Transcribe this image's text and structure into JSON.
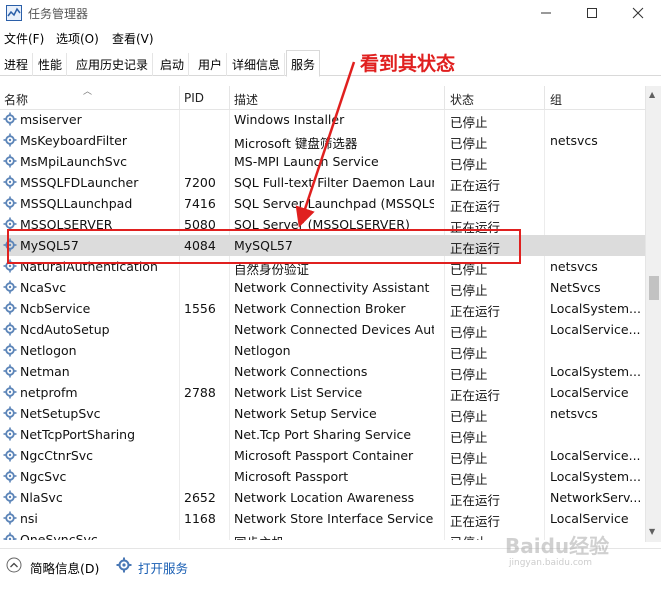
{
  "window": {
    "title": "任务管理器",
    "controls": {
      "minimize_icon": "minimize-icon",
      "maximize_icon": "maximize-icon",
      "close_icon": "close-icon"
    }
  },
  "menu": [
    "文件(F)",
    "选项(O)",
    "查看(V)"
  ],
  "tabs": [
    {
      "label": "进程",
      "active": false
    },
    {
      "label": "性能",
      "active": false
    },
    {
      "label": "应用历史记录",
      "active": false
    },
    {
      "label": "启动",
      "active": false
    },
    {
      "label": "用户",
      "active": false
    },
    {
      "label": "详细信息",
      "active": false
    },
    {
      "label": "服务",
      "active": true
    }
  ],
  "columns": {
    "name": "名称",
    "pid": "PID",
    "description": "描述",
    "status": "状态",
    "group": "组"
  },
  "rows": [
    {
      "name": "msiserver",
      "pid": "",
      "description": "Windows Installer",
      "status": "已停止",
      "group": ""
    },
    {
      "name": "MsKeyboardFilter",
      "pid": "",
      "description": "Microsoft 键盘筛选器",
      "status": "已停止",
      "group": "netsvcs"
    },
    {
      "name": "MsMpiLaunchSvc",
      "pid": "",
      "description": "MS-MPI Launch Service",
      "status": "已停止",
      "group": ""
    },
    {
      "name": "MSSQLFDLauncher",
      "pid": "7200",
      "description": "SQL Full-text Filter Daemon Laun...",
      "status": "正在运行",
      "group": ""
    },
    {
      "name": "MSSQLLaunchpad",
      "pid": "7416",
      "description": "SQL Server Launchpad (MSSQLS...",
      "status": "正在运行",
      "group": ""
    },
    {
      "name": "MSSQLSERVER",
      "pid": "5080",
      "description": "SQL Server (MSSQLSERVER)",
      "status": "正在运行",
      "group": ""
    },
    {
      "name": "MySQL57",
      "pid": "4084",
      "description": "MySQL57",
      "status": "正在运行",
      "group": "",
      "selected": true
    },
    {
      "name": "NaturalAuthentication",
      "pid": "",
      "description": "自然身份验证",
      "status": "已停止",
      "group": "netsvcs"
    },
    {
      "name": "NcaSvc",
      "pid": "",
      "description": "Network Connectivity Assistant",
      "status": "已停止",
      "group": "NetSvcs"
    },
    {
      "name": "NcbService",
      "pid": "1556",
      "description": "Network Connection Broker",
      "status": "正在运行",
      "group": "LocalSystem..."
    },
    {
      "name": "NcdAutoSetup",
      "pid": "",
      "description": "Network Connected Devices Auto...",
      "status": "已停止",
      "group": "LocalService..."
    },
    {
      "name": "Netlogon",
      "pid": "",
      "description": "Netlogon",
      "status": "已停止",
      "group": ""
    },
    {
      "name": "Netman",
      "pid": "",
      "description": "Network Connections",
      "status": "已停止",
      "group": "LocalSystem..."
    },
    {
      "name": "netprofm",
      "pid": "2788",
      "description": "Network List Service",
      "status": "正在运行",
      "group": "LocalService"
    },
    {
      "name": "NetSetupSvc",
      "pid": "",
      "description": "Network Setup Service",
      "status": "已停止",
      "group": "netsvcs"
    },
    {
      "name": "NetTcpPortSharing",
      "pid": "",
      "description": "Net.Tcp Port Sharing Service",
      "status": "已停止",
      "group": ""
    },
    {
      "name": "NgcCtnrSvc",
      "pid": "",
      "description": "Microsoft Passport Container",
      "status": "已停止",
      "group": "LocalService..."
    },
    {
      "name": "NgcSvc",
      "pid": "",
      "description": "Microsoft Passport",
      "status": "已停止",
      "group": "LocalSystem..."
    },
    {
      "name": "NlaSvc",
      "pid": "2652",
      "description": "Network Location Awareness",
      "status": "正在运行",
      "group": "NetworkServ..."
    },
    {
      "name": "nsi",
      "pid": "1168",
      "description": "Network Store Interface Service",
      "status": "正在运行",
      "group": "LocalService"
    },
    {
      "name": "OneSyncSvc",
      "pid": "",
      "description": "同步主机",
      "status": "已停止",
      "group": ""
    }
  ],
  "footer": {
    "fewer_details": "简略信息(D)",
    "open_services": "打开服务"
  },
  "annotation": {
    "text": "看到其状态",
    "color": "#e0201f"
  },
  "watermark": {
    "main": "Baidu经验",
    "sub": "jingyan.baidu.com"
  },
  "colors": {
    "selected_row": "#dcdcdc",
    "link": "#1a5fb4",
    "annotation": "#e0201f"
  }
}
